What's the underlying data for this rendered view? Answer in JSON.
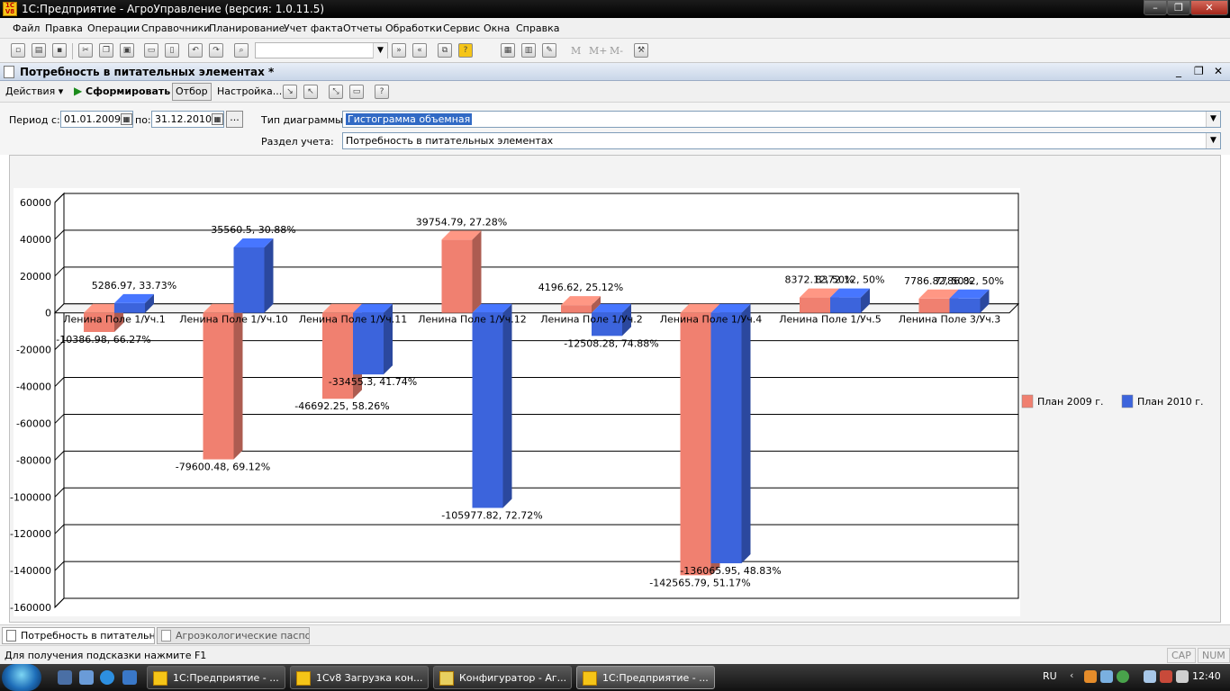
{
  "window": {
    "title": "1С:Предприятие - АгроУправление (версия: 1.0.11.5)"
  },
  "menu": [
    "Файл",
    "Правка",
    "Операции",
    "Справочники",
    "Планирование",
    "Учет факта",
    "Отчеты",
    "Обработки",
    "Сервис",
    "Окна",
    "Справка"
  ],
  "document": {
    "title": "Потребность в питательных элементах *"
  },
  "actions": {
    "actions_label": "Действия",
    "generate_label": "Сформировать",
    "filter_label": "Отбор",
    "settings_label": "Настройка..."
  },
  "form": {
    "period_from_label": "Период с:",
    "period_from_value": "01.01.2009",
    "period_to_label": "по:",
    "period_to_value": "31.12.2010",
    "chart_type_label": "Тип диаграммы:",
    "chart_type_value": "Гистограмма объемная",
    "section_label": "Раздел учета:",
    "section_value": "Потребность в питательных элементах"
  },
  "chart_data": {
    "type": "bar",
    "categories": [
      "Ленина Поле 1/Уч.1",
      "Ленина Поле 1/Уч.10",
      "Ленина Поле 1/Уч.11",
      "Ленина Поле 1/Уч.12",
      "Ленина Поле 1/Уч.2",
      "Ленина Поле 1/Уч.4",
      "Ленина Поле 1/Уч.5",
      "Ленина Поле 3/Уч.3"
    ],
    "series": [
      {
        "name": "План 2009 г.",
        "color": "#f08070",
        "values": [
          -10386.98,
          -79600.48,
          -46692.25,
          39754.79,
          4196.62,
          -142565.79,
          8372.12,
          7786.82
        ],
        "labels": [
          "-10386.98, 66.27%",
          "-79600.48, 69.12%",
          "-46692.25, 58.26%",
          "39754.79, 27.28%",
          "4196.62, 25.12%",
          "-142565.79, 51.17%",
          "8372.12, 50%",
          "7786.82, 50%"
        ]
      },
      {
        "name": "План 2010 г.",
        "color": "#3c64dc",
        "values": [
          5286.97,
          35560.5,
          -33455.3,
          -105977.82,
          -12508.28,
          -136065.95,
          8372.12,
          7786.82
        ],
        "labels": [
          "5286.97, 33.73%",
          "35560.5, 30.88%",
          "-33455.3, 41.74%",
          "-105977.82, 72.72%",
          "-12508.28, 74.88%",
          "-136065.95, 48.83%",
          "8372.12, 50%",
          "7786.82, 50%"
        ]
      }
    ],
    "yticks": [
      "60000",
      "40000",
      "20000",
      "0",
      "-20000",
      "-40000",
      "-60000",
      "-80000",
      "-100000",
      "-120000",
      "-140000",
      "-160000"
    ],
    "ylim": [
      -160000,
      60000
    ],
    "legend": "right",
    "grid": true
  },
  "window_tabs": [
    "Потребность в питательных...",
    "Агроэкологические паспор..."
  ],
  "status": {
    "hint": "Для получения подсказки нажмите F1",
    "caps": "CAP",
    "num": "NUM"
  },
  "taskbar": {
    "tasks": [
      "1С:Предприятие - ...",
      "1Cv8 Загрузка кон...",
      "Конфигуратор - Аг...",
      "1С:Предприятие - ..."
    ],
    "lang": "RU",
    "clock": "12:40"
  }
}
